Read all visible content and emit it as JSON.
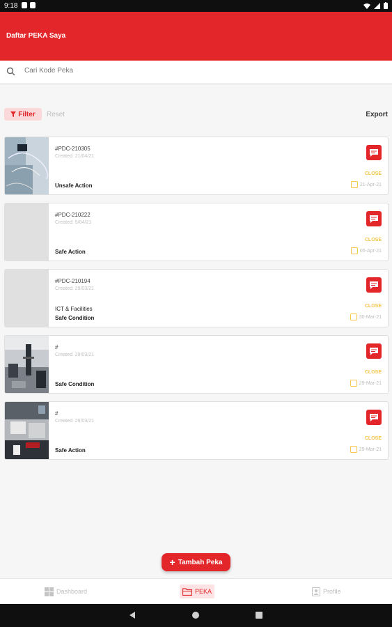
{
  "status_bar": {
    "time": "9:18"
  },
  "app_bar": {
    "title": "Daftar PEKA Saya"
  },
  "search": {
    "placeholder": "Cari Kode Peka"
  },
  "toolbar": {
    "filter_label": "Filter",
    "reset_label": "Reset",
    "export_label": "Export"
  },
  "cards": [
    {
      "code": "#PDC-210305",
      "created": "Created: 21/04/21",
      "category": "",
      "type": "Unsafe Action",
      "status": "CLOSE",
      "date": "21-Apr-21"
    },
    {
      "code": "#PDC-210222",
      "created": "Created: 5/04/21",
      "category": "",
      "type": "Safe Action",
      "status": "CLOSE",
      "date": "05-Apr-21"
    },
    {
      "code": "#PDC-210194",
      "created": "Created: 29/03/21",
      "category": "ICT & Facilities",
      "type": "Safe Condition",
      "status": "CLOSE",
      "date": "30-Mar-21"
    },
    {
      "code": "#",
      "created": "Created: 29/03/21",
      "category": "",
      "type": "Safe Condition",
      "status": "CLOSE",
      "date": "29-Mar-21"
    },
    {
      "code": "#",
      "created": "Created: 29/03/21",
      "category": "",
      "type": "Safe Action",
      "status": "CLOSE",
      "date": "29-Mar-21"
    }
  ],
  "fab": {
    "label": "Tambah Peka"
  },
  "bottom_nav": {
    "dashboard": "Dashboard",
    "peka": "PEKA",
    "profile": "Profile"
  },
  "colors": {
    "primary": "#e3262a",
    "status_close": "#f5c64a"
  }
}
